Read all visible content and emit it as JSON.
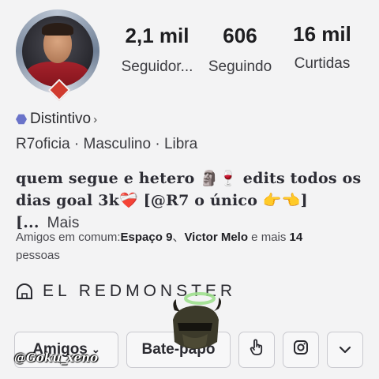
{
  "profile": {
    "stats": [
      {
        "value": "2,1 mil",
        "label": "Seguidor..."
      },
      {
        "value": "606",
        "label": "Seguindo"
      },
      {
        "value": "16 mil",
        "label": "Curtidas"
      }
    ],
    "badge_label": "Distintivo",
    "meta": "R7oficia · Masculino · Libra",
    "bio_line1": "quem segue e hetero 🗿🍷 edits todos os",
    "bio_line2": "dias goal 3k❤️‍🩹 [@R7 o único 👉👈][...",
    "bio_more": "Mais",
    "friends_prefix": "Amigos em comum:",
    "friend1": "Espaço 9",
    "friend_sep": "、",
    "friend2": "Victor Melo",
    "friends_mid": " e mais ",
    "friends_count": "14",
    "friends_suffix": "pessoas",
    "brand": "EL REDMONSTER"
  },
  "actions": {
    "friends_button": "Amigos",
    "chat_button": "Bate-papo"
  },
  "overlay": {
    "watermark": "@Goku_xeno"
  },
  "icons": {
    "badge": "hexagon-icon",
    "brand": "arch-icon",
    "chevron": "chevron-down-icon",
    "hand": "hand-pointer-icon",
    "instagram": "instagram-icon"
  },
  "colors": {
    "background": "#f3f3f4",
    "badge_hex": "#6a73c9",
    "text": "#2a2a2e"
  }
}
